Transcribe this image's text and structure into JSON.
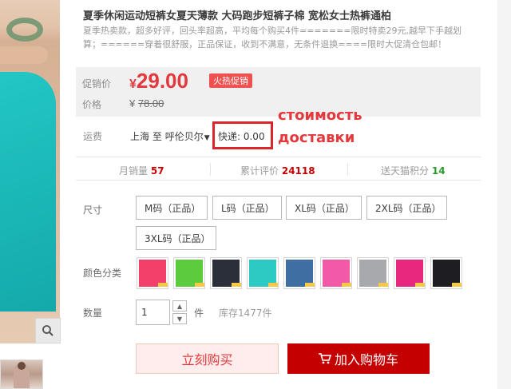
{
  "product": {
    "title": "夏季休闲运动短裤女夏天薄款 大码跑步短裤子棉 宽松女士热裤通柏",
    "subtitle_line1": "夏季热卖款，超多好评，回头率超高，平均每个购买4件=======限时特卖29元,越早下手越划",
    "subtitle_line2": "算；======穿着很舒服，正品保证，收到不满意，无条件退换====限时大促清仓包邮！"
  },
  "price": {
    "label": "促销价",
    "currency": "¥",
    "amount": "29.00",
    "promo_tag": "火热促销",
    "original_label": "价格",
    "original_currency": "¥",
    "original_amount": "78.00"
  },
  "annotation": {
    "line1": "стоимость",
    "line2": "доставки",
    "color": "#e4393c"
  },
  "shipping": {
    "label": "运费",
    "from": "上海",
    "to_word": "至",
    "destination": "呼伦贝尔",
    "fee": "快递: 0.00"
  },
  "stats": {
    "monthly_sales_label": "月销量",
    "monthly_sales": "57",
    "reviews_label": "累计评价",
    "reviews": "24118",
    "points_label": "送天猫积分",
    "points": "14"
  },
  "size": {
    "label": "尺寸",
    "options": [
      "M码（正品）",
      "L码（正品）",
      "XL码（正品）",
      "2XL码（正品）",
      "3XL码（正品）"
    ]
  },
  "color": {
    "label": "颜色分类",
    "swatches": [
      "#f2406b",
      "#5ccb3e",
      "#2b2f3a",
      "#2dc9c3",
      "#3f6ea3",
      "#f25aa8",
      "#a7a9ac",
      "#e8287f",
      "#1e1e22"
    ]
  },
  "quantity": {
    "label": "数量",
    "value": "1",
    "unit": "件",
    "stock": "库存1477件"
  },
  "actions": {
    "buy_now": "立刻购买",
    "add_to_cart": "加入购物车"
  }
}
